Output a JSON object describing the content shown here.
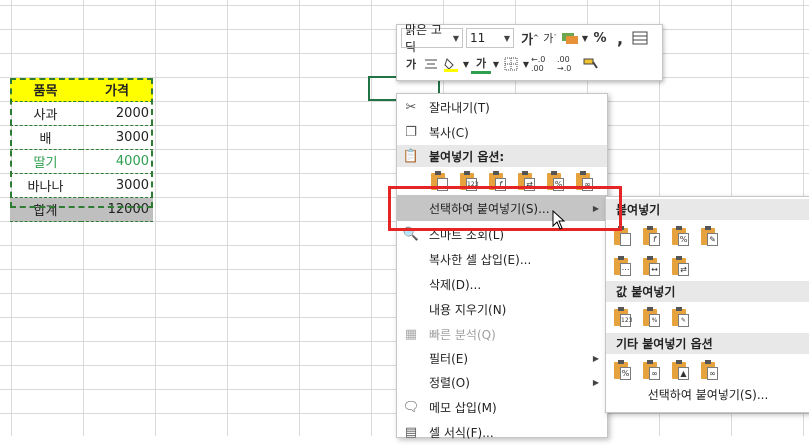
{
  "table": {
    "headers": [
      "품목",
      "가격"
    ],
    "rows": [
      {
        "item": "사과",
        "price": "2000"
      },
      {
        "item": "배",
        "price": "3000"
      },
      {
        "item": "딸기",
        "price": "4000"
      },
      {
        "item": "바나나",
        "price": "3000"
      }
    ],
    "total": {
      "label": "합계",
      "value": "12000"
    }
  },
  "mini_toolbar": {
    "font_name": "맑은 고딕",
    "font_size": "11",
    "grow_font": "가",
    "shrink_font": "가",
    "percent": "%",
    "comma": ",",
    "bold": "가",
    "font_color_letter": "가",
    "inc_decimal": "←.0 .00",
    "dec_decimal": ".00 →.0"
  },
  "context_menu": {
    "cut": "잘라내기(T)",
    "copy": "복사(C)",
    "paste_options": "붙여넣기 옵션:",
    "paste_special": "선택하여 붙여넣기(S)...",
    "smart_lookup": "스마트 조회(L)",
    "insert_copied": "복사한 셀 삽입(E)...",
    "delete": "삭제(D)...",
    "clear": "내용 지우기(N)",
    "quick_analysis": "빠른 분석(Q)",
    "filter": "필터(E)",
    "sort": "정렬(O)",
    "insert_comment": "메모 삽입(M)",
    "format_cells": "셀 서식(F)..."
  },
  "submenu": {
    "paste": "붙여넣기",
    "paste_values": "값 붙여넣기",
    "other_options": "기타 붙여넣기 옵션",
    "paste_special_link": "선택하여 붙여넣기(S)..."
  },
  "colors": {
    "header_fill": "#ffff00",
    "total_fill": "#bfbfbf",
    "highlight_text": "#2e9e4f",
    "highlight_box": "#e52424",
    "selection": "#217346"
  }
}
